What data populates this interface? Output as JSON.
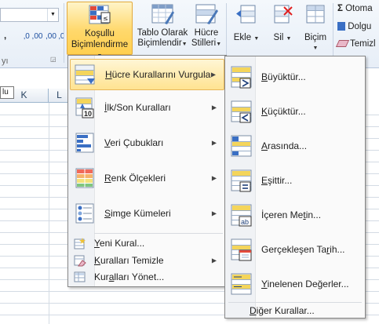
{
  "ribbon": {
    "number_combo_value": "",
    "number_format_buttons": [
      ",",
      "‚0 ,00",
      ",00 ‚0"
    ],
    "conditional_formatting_label_line1": "Koşullu",
    "conditional_formatting_label_line2": "Biçimlendirme",
    "format_as_table_line1": "Tablo Olarak",
    "format_as_table_line2": "Biçimlendir",
    "cell_styles_line1": "Hücre",
    "cell_styles_line2": "Stilleri",
    "insert_label": "Ekle",
    "delete_label": "Sil",
    "format_label": "Biçim",
    "autosum_label": "Otoma",
    "fill_label": "Dolgu",
    "clear_label": "Temizl",
    "group_label_fragment": "yı"
  },
  "sheet": {
    "column_k": "K",
    "column_l": "L",
    "tooltip_fragment": "lu"
  },
  "main_menu": {
    "items": [
      {
        "label": "Hücre Kurallarını Vurgula",
        "u": "H",
        "rest": "ücre Kurallarını Vurgula",
        "submenu": true,
        "icon": "highlight-cells-icon"
      },
      {
        "label": "İlk/Son Kuralları",
        "u": "İ",
        "rest": "lk/Son Kuralları",
        "submenu": true,
        "icon": "top-bottom-icon"
      },
      {
        "label": "Veri Çubukları",
        "u": "V",
        "rest": "eri Çubukları",
        "submenu": true,
        "icon": "data-bars-icon"
      },
      {
        "label": "Renk Ölçekleri",
        "u": "R",
        "rest": "enk Ölçekleri",
        "submenu": true,
        "icon": "color-scales-icon"
      },
      {
        "label": "Simge Kümeleri",
        "u": "S",
        "rest": "imge Kümeleri",
        "submenu": true,
        "icon": "icon-sets-icon"
      }
    ],
    "new_rule": {
      "pre": "",
      "u": "Y",
      "rest": "eni Kural..."
    },
    "clear_rules": {
      "pre": "",
      "u": "K",
      "rest": "uralları Temizle"
    },
    "manage_rules": {
      "pre": "Kur",
      "u": "a",
      "rest": "lları Yönet..."
    },
    "top_label": "10"
  },
  "sub_menu": {
    "items": [
      {
        "pre": "",
        "u": "B",
        "rest": "üyüktür...",
        "icon": "greater-than-icon"
      },
      {
        "pre": "",
        "u": "K",
        "rest": "üçüktür...",
        "icon": "less-than-icon"
      },
      {
        "pre": "",
        "u": "A",
        "rest": "rasında...",
        "icon": "between-icon"
      },
      {
        "pre": "",
        "u": "E",
        "rest": "şittir...",
        "icon": "equal-to-icon"
      },
      {
        "pre": "İçeren Me",
        "u": "t",
        "rest": "in...",
        "icon": "text-contains-icon"
      },
      {
        "pre": "Gerçekleşen Ta",
        "u": "r",
        "rest": "ih...",
        "icon": "date-occurring-icon"
      },
      {
        "pre": "",
        "u": "Y",
        "rest": "inelenen Değerler...",
        "icon": "duplicate-values-icon"
      }
    ],
    "more_rules": {
      "pre": "",
      "u": "D",
      "rest": "iğer Kurallar..."
    },
    "icon_glyphs": {
      "lt": "<",
      "eq": "=",
      "ab": "ab"
    }
  }
}
